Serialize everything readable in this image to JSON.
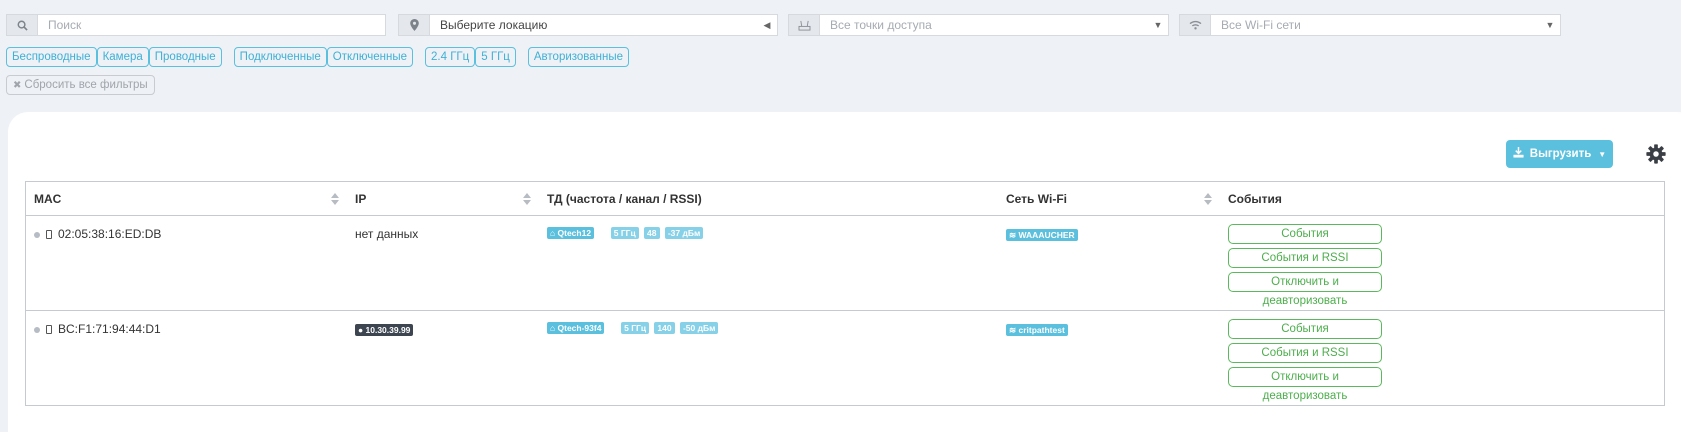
{
  "filters": {
    "search_placeholder": "Поиск",
    "location": "Выберите локацию",
    "access_points": "Все точки доступа",
    "wifi_networks": "Все Wi-Fi сети"
  },
  "chips": [
    "Беспроводные",
    "Камера",
    "Проводные",
    "Подключенные",
    "Отключенные",
    "2.4 ГГц",
    "5 ГГц",
    "Авторизованные"
  ],
  "reset_label": "Сбросить все фильтры",
  "toolbar": {
    "export_label": "Выгрузить"
  },
  "table": {
    "columns": [
      "MAC",
      "IP",
      "ТД (частота / канал / RSSI)",
      "Сеть Wi-Fi",
      "События"
    ],
    "rows": [
      {
        "mac": "02:05:38:16:ED:DB",
        "ip": "нет данных",
        "ap": "Qtech12",
        "freq": "5 ГГц",
        "channel": "48",
        "rssi": "-37 дБм",
        "wifi": "WAAAUCHER",
        "actions": [
          "События",
          "События и RSSI",
          "Отключить и деавторизовать"
        ]
      },
      {
        "mac": "BC:F1:71:94:44:D1",
        "ip": "10.30.39.99",
        "ap": "Qtech-93f4",
        "freq": "5 ГГц",
        "channel": "140",
        "rssi": "-50 дБм",
        "wifi": "critpathtest",
        "actions": [
          "События",
          "События и RSSI",
          "Отключить и деавторизовать"
        ]
      }
    ]
  },
  "colors": {
    "accent": "#5bc0de",
    "success": "#5cb85c",
    "background": "#eef1f5"
  }
}
